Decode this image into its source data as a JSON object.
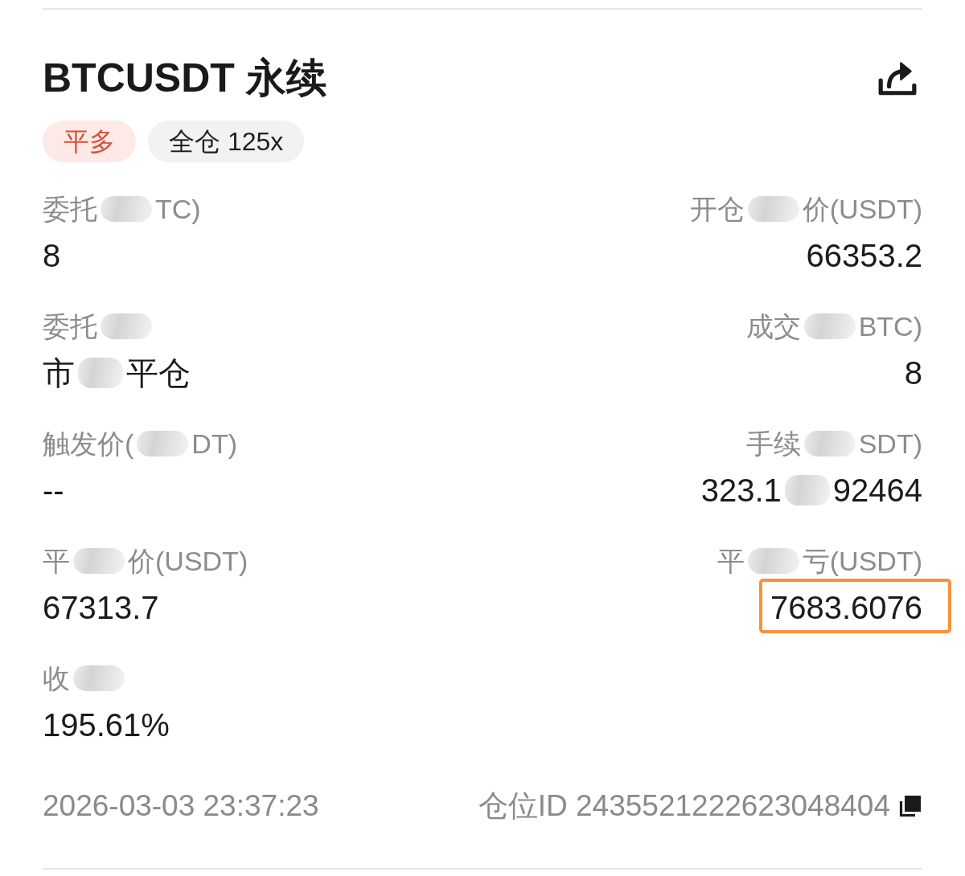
{
  "header": {
    "title": "BTCUSDT 永续"
  },
  "tags": [
    {
      "kind": "direction",
      "text": "平多"
    },
    {
      "kind": "margin",
      "text": "全仓 125x"
    }
  ],
  "fields": [
    {
      "label": [
        {
          "kind": "text",
          "text": "委托"
        },
        {
          "kind": "smudge"
        },
        {
          "kind": "text",
          "text": "TC)"
        }
      ],
      "value": [
        {
          "kind": "text",
          "text": "8"
        }
      ],
      "highlighted": false
    },
    {
      "label": [
        {
          "kind": "text",
          "text": "开仓"
        },
        {
          "kind": "smudge"
        },
        {
          "kind": "text",
          "text": "价(USDT)"
        }
      ],
      "value": [
        {
          "kind": "text",
          "text": "66353.2"
        }
      ],
      "highlighted": false
    },
    {
      "label": [
        {
          "kind": "text",
          "text": "委托"
        },
        {
          "kind": "smudge"
        }
      ],
      "value": [
        {
          "kind": "text",
          "text": "市"
        },
        {
          "kind": "smudge"
        },
        {
          "kind": "text",
          "text": "平仓"
        }
      ],
      "highlighted": false
    },
    {
      "label": [
        {
          "kind": "text",
          "text": "成交"
        },
        {
          "kind": "smudge"
        },
        {
          "kind": "text",
          "text": "BTC)"
        }
      ],
      "value": [
        {
          "kind": "text",
          "text": "8"
        }
      ],
      "highlighted": false
    },
    {
      "label": [
        {
          "kind": "text",
          "text": "触发价("
        },
        {
          "kind": "smudge"
        },
        {
          "kind": "text",
          "text": "DT)"
        }
      ],
      "value": [
        {
          "kind": "text",
          "text": "--"
        }
      ],
      "highlighted": false
    },
    {
      "label": [
        {
          "kind": "text",
          "text": "手续"
        },
        {
          "kind": "smudge"
        },
        {
          "kind": "text",
          "text": "SDT)"
        }
      ],
      "value": [
        {
          "kind": "text",
          "text": "323.1"
        },
        {
          "kind": "smudge"
        },
        {
          "kind": "text",
          "text": "92464"
        }
      ],
      "highlighted": false
    },
    {
      "label": [
        {
          "kind": "text",
          "text": "平"
        },
        {
          "kind": "smudge"
        },
        {
          "kind": "text",
          "text": "价(USDT)"
        }
      ],
      "value": [
        {
          "kind": "text",
          "text": "67313.7"
        }
      ],
      "highlighted": false
    },
    {
      "label": [
        {
          "kind": "text",
          "text": "平"
        },
        {
          "kind": "smudge"
        },
        {
          "kind": "text",
          "text": "亏(USDT)"
        }
      ],
      "value": [
        {
          "kind": "text",
          "text": "7683.6076"
        }
      ],
      "highlighted": true
    },
    {
      "label": [
        {
          "kind": "text",
          "text": "收"
        },
        {
          "kind": "smudge"
        }
      ],
      "value": [
        {
          "kind": "text",
          "text": "195.61%"
        }
      ],
      "highlighted": false
    }
  ],
  "footer": {
    "time": "2026-03-03 23:37:23",
    "position_id": "仓位ID 2435521222623048404"
  }
}
